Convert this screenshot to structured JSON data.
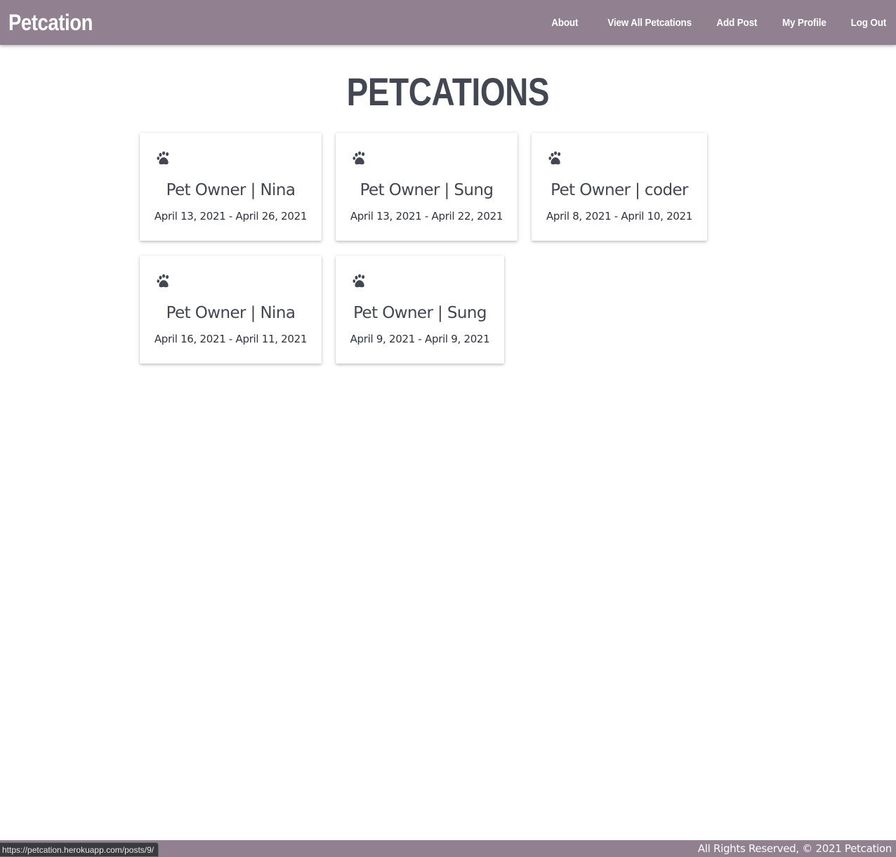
{
  "navbar": {
    "brand": "Petcation",
    "links": [
      {
        "label": "About"
      },
      {
        "label": "View All Petcations"
      },
      {
        "label": "Add Post"
      },
      {
        "label": "My Profile"
      },
      {
        "label": "Log Out"
      }
    ]
  },
  "main": {
    "title": "PETCATIONS",
    "cards": [
      {
        "icon": "paw-icon",
        "owner": "Pet Owner | Nina",
        "dates": "April 13, 2021 - April 26, 2021"
      },
      {
        "icon": "paw-icon",
        "owner": "Pet Owner | Sung",
        "dates": "April 13, 2021 - April 22, 2021"
      },
      {
        "icon": "paw-icon",
        "owner": "Pet Owner | coder",
        "dates": "April 8, 2021 - April 10, 2021"
      },
      {
        "icon": "paw-icon",
        "owner": "Pet Owner | Nina",
        "dates": "April 16, 2021 - April 11, 2021"
      },
      {
        "icon": "paw-icon",
        "owner": "Pet Owner | Sung",
        "dates": "April 9, 2021 - April 9, 2021"
      }
    ]
  },
  "footer": {
    "text": "All Rights Reserved, © 2021 Petcation"
  },
  "status_bar": {
    "url": "https://petcation.herokuapp.com/posts/9/"
  },
  "colors": {
    "navbar_bg": "#908090",
    "text_dark": "#434752",
    "page_bg": "#ffffff"
  }
}
